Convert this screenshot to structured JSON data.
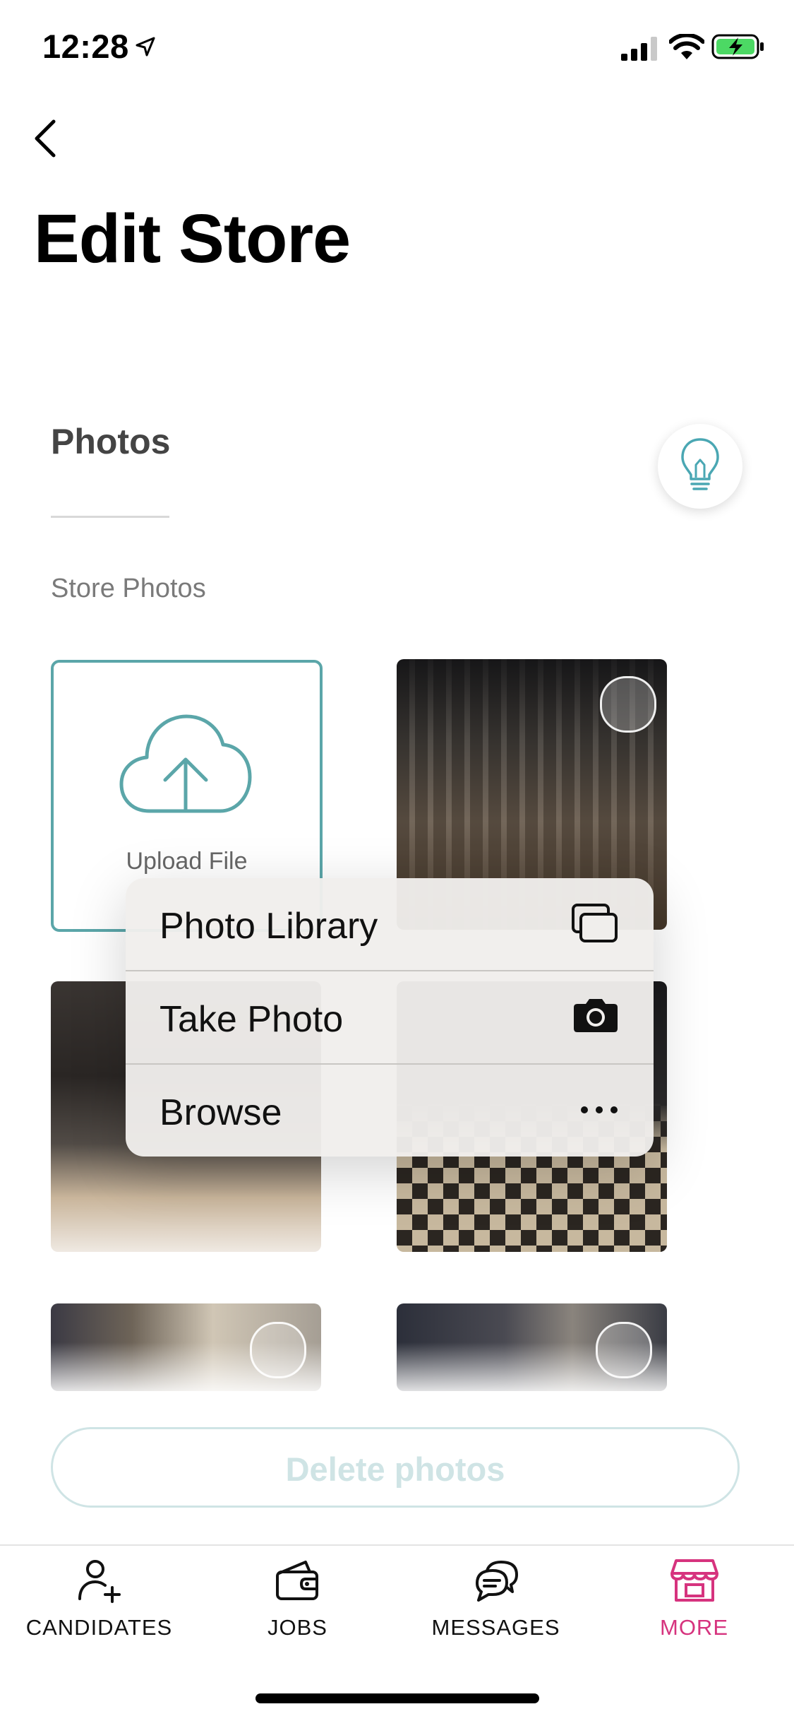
{
  "status_bar": {
    "time": "12:28"
  },
  "header": {
    "title": "Edit Store"
  },
  "section": {
    "title": "Photos",
    "subtitle": "Store Photos"
  },
  "upload": {
    "label": "Upload File"
  },
  "context_menu": {
    "items": [
      {
        "label": "Photo Library",
        "icon": "photo-library-icon"
      },
      {
        "label": "Take Photo",
        "icon": "camera-icon"
      },
      {
        "label": "Browse",
        "icon": "ellipsis-icon"
      }
    ]
  },
  "actions": {
    "delete_label": "Delete photos"
  },
  "tabbar": {
    "items": [
      {
        "label": "CANDIDATES",
        "icon": "add-person-icon"
      },
      {
        "label": "JOBS",
        "icon": "wallet-icon"
      },
      {
        "label": "MESSAGES",
        "icon": "chat-bubbles-icon"
      },
      {
        "label": "MORE",
        "icon": "store-icon",
        "active": true
      }
    ]
  },
  "colors": {
    "accent_teal": "#5ba6a9",
    "active_tab": "#d6337e",
    "battery_green": "#4cd964"
  }
}
